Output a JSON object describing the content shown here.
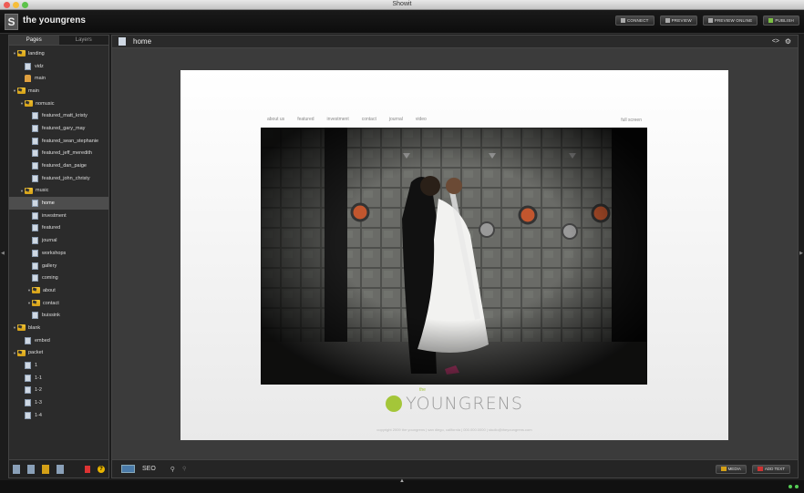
{
  "window": {
    "title": "Showit"
  },
  "header": {
    "logo_letter": "S",
    "app_name": "the youngrens",
    "buttons": [
      {
        "label": "CONNECT",
        "name": "connect-button",
        "icon": "connect-icon"
      },
      {
        "label": "PREVIEW",
        "name": "preview-button",
        "icon": "preview-icon"
      },
      {
        "label": "PREVIEW ONLINE",
        "name": "preview-online-button",
        "icon": "preview-online-icon"
      },
      {
        "label": "PUBLISH",
        "name": "publish-button",
        "icon": "publish-icon"
      }
    ]
  },
  "sidebar": {
    "tabs": [
      {
        "label": "Pages",
        "active": true
      },
      {
        "label": "Layers",
        "active": false
      }
    ],
    "tree": [
      {
        "label": "landing",
        "type": "folder",
        "level": 0,
        "arrow": true
      },
      {
        "label": "vidz",
        "type": "page",
        "level": 1
      },
      {
        "label": "main",
        "type": "lock",
        "level": 1
      },
      {
        "label": "main",
        "type": "folder",
        "level": 0,
        "arrow": true
      },
      {
        "label": "nomusic",
        "type": "folder",
        "level": 1,
        "arrow": true
      },
      {
        "label": "featured_matt_kristy",
        "type": "page",
        "level": 2
      },
      {
        "label": "featured_gary_may",
        "type": "page",
        "level": 2
      },
      {
        "label": "featured_sean_stephanie",
        "type": "page",
        "level": 2
      },
      {
        "label": "featured_jeff_meredith",
        "type": "page",
        "level": 2
      },
      {
        "label": "featured_dan_paige",
        "type": "page",
        "level": 2
      },
      {
        "label": "featured_john_christy",
        "type": "page",
        "level": 2
      },
      {
        "label": "music",
        "type": "folder",
        "level": 1,
        "arrow": true
      },
      {
        "label": "home",
        "type": "page",
        "level": 2,
        "selected": true
      },
      {
        "label": "investment",
        "type": "page",
        "level": 2
      },
      {
        "label": "featured",
        "type": "page",
        "level": 2
      },
      {
        "label": "journal",
        "type": "page",
        "level": 2
      },
      {
        "label": "workshops",
        "type": "page",
        "level": 2
      },
      {
        "label": "gallery",
        "type": "page",
        "level": 2
      },
      {
        "label": "coming",
        "type": "page",
        "level": 2
      },
      {
        "label": "about",
        "type": "folder",
        "level": 2,
        "arrow": true
      },
      {
        "label": "contact",
        "type": "folder",
        "level": 2,
        "arrow": true
      },
      {
        "label": "buissink",
        "type": "page",
        "level": 2
      },
      {
        "label": "blank",
        "type": "folder",
        "level": 0,
        "arrow": true
      },
      {
        "label": "embed",
        "type": "page",
        "level": 1
      },
      {
        "label": "packet",
        "type": "folder",
        "level": 0,
        "arrow": true
      },
      {
        "label": "1",
        "type": "page",
        "level": 1
      },
      {
        "label": "1-1",
        "type": "page",
        "level": 1
      },
      {
        "label": "1-2",
        "type": "page",
        "level": 1
      },
      {
        "label": "1-3",
        "type": "page",
        "level": 1
      },
      {
        "label": "1-4",
        "type": "page",
        "level": 1
      }
    ],
    "footer_help": "?"
  },
  "canvas": {
    "title": "home",
    "site": {
      "nav": [
        "about us",
        "featured",
        "investment",
        "contact",
        "journal",
        "video"
      ],
      "fullscreen": "full screen",
      "brand_the": "the",
      "brand_word": "YOUNGRENS",
      "copyright": "copyright 2009 the youngrens | san diego, california | 000.000.0000 | studio@theyoungrens.com"
    },
    "footer": {
      "seo_label": "SEO",
      "media_label": "MEDIA",
      "add_text_label": "ADD TEXT"
    }
  },
  "colors": {
    "accent_green": "#a4c639",
    "folder_yellow": "#d4a017"
  }
}
